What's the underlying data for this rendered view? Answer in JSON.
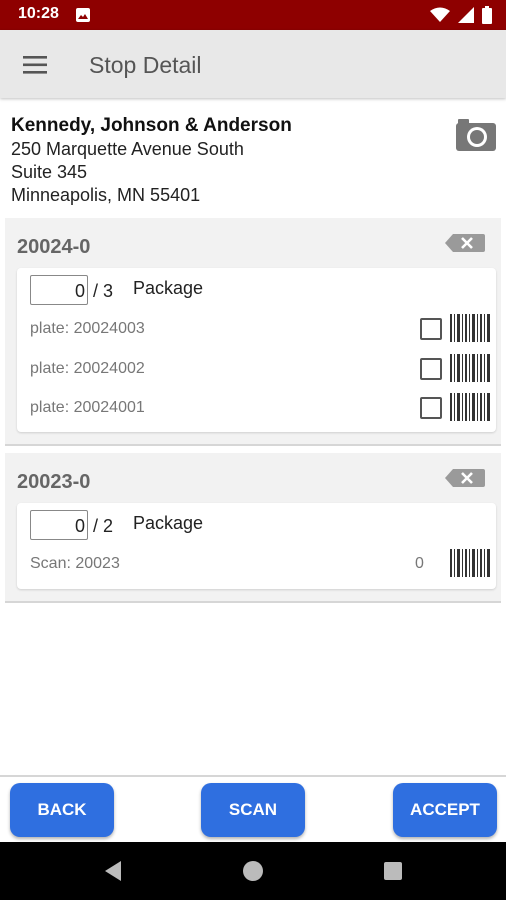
{
  "status_bar": {
    "time": "10:28"
  },
  "app_bar": {
    "title": "Stop Detail"
  },
  "stop": {
    "name": "Kennedy, Johnson & Anderson",
    "address_line1": "250 Marquette Avenue South",
    "address_line2": "Suite 345",
    "address_line3": "Minneapolis, MN 55401"
  },
  "orders": [
    {
      "id": "20024-0",
      "quantity": "0",
      "total": "/ 3",
      "type": "Package",
      "plates": [
        "plate: 20024003",
        "plate: 20024002",
        "plate: 20024001"
      ]
    },
    {
      "id": "20023-0",
      "quantity": "0",
      "total": "/ 2",
      "type": "Package",
      "scan_label": "Scan: 20023",
      "scan_count": "0"
    }
  ],
  "buttons": {
    "back": "BACK",
    "scan": "SCAN",
    "accept": "ACCEPT"
  },
  "colors": {
    "status_bar": "#8e0000",
    "primary_button": "#2f6fe0",
    "app_bar": "#e8e8e8"
  },
  "icons": [
    "menu-icon",
    "camera-icon",
    "delete-icon",
    "checkbox-icon",
    "barcode-icon",
    "wifi-icon",
    "signal-icon",
    "battery-icon"
  ]
}
